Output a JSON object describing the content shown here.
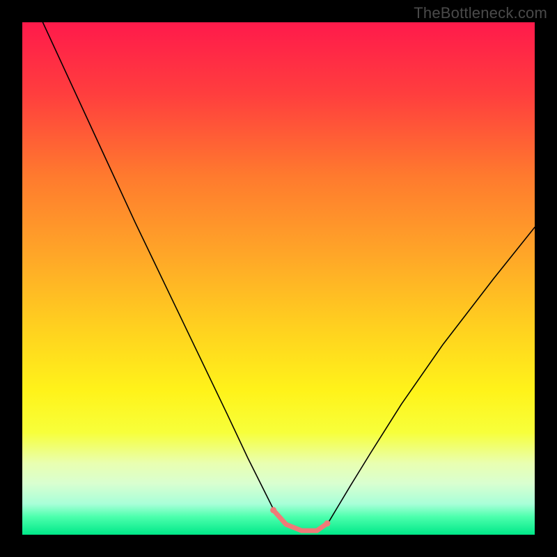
{
  "watermark": "TheBottleneck.com",
  "chart_data": {
    "type": "line",
    "title": "",
    "xlabel": "",
    "ylabel": "",
    "xlim": [
      0,
      100
    ],
    "ylim": [
      0,
      100
    ],
    "grid": false,
    "legend": false,
    "gradient_stops": [
      {
        "offset": 0.0,
        "color": "#ff1a4b"
      },
      {
        "offset": 0.14,
        "color": "#ff3e3e"
      },
      {
        "offset": 0.3,
        "color": "#ff7a2e"
      },
      {
        "offset": 0.45,
        "color": "#ffa528"
      },
      {
        "offset": 0.6,
        "color": "#ffd21f"
      },
      {
        "offset": 0.72,
        "color": "#fff31a"
      },
      {
        "offset": 0.8,
        "color": "#f7ff3a"
      },
      {
        "offset": 0.86,
        "color": "#e9ffb0"
      },
      {
        "offset": 0.9,
        "color": "#d9ffd0"
      },
      {
        "offset": 0.94,
        "color": "#a8ffd8"
      },
      {
        "offset": 0.965,
        "color": "#4cffad"
      },
      {
        "offset": 1.0,
        "color": "#00e888"
      }
    ],
    "series": [
      {
        "name": "curve",
        "color": "#000000",
        "width": 1.6,
        "x": [
          4.0,
          10.0,
          16.0,
          22.0,
          28.0,
          34.0,
          40.0,
          44.0,
          47.0,
          49.0,
          51.5,
          54.5,
          57.5,
          59.5,
          61.0,
          64.0,
          68.0,
          74.0,
          82.0,
          92.0,
          100.0
        ],
        "y": [
          100.0,
          87.0,
          74.0,
          61.0,
          48.5,
          36.0,
          23.5,
          15.0,
          9.0,
          5.0,
          2.0,
          0.8,
          0.8,
          2.0,
          4.5,
          9.5,
          16.0,
          25.5,
          37.0,
          50.0,
          60.0
        ]
      },
      {
        "name": "flat-marker",
        "color": "#ef7a78",
        "width": 7.0,
        "marker_radius": 4.5,
        "x": [
          49.0,
          51.5,
          54.5,
          57.5,
          59.5
        ],
        "y": [
          4.8,
          2.0,
          0.8,
          0.8,
          2.2
        ]
      }
    ]
  }
}
